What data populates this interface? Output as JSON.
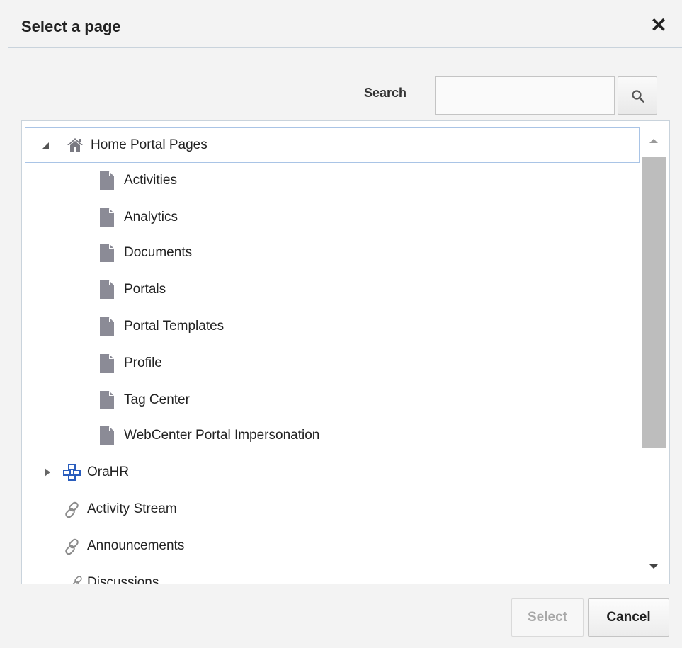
{
  "dialog": {
    "title": "Select a page",
    "close_symbol": "✕"
  },
  "search": {
    "label": "Search",
    "value": "",
    "placeholder": ""
  },
  "tree": {
    "root": {
      "label": "Home Portal Pages",
      "icon": "home-icon",
      "expanded": true,
      "children": [
        "Activities",
        "Analytics",
        "Documents",
        "Portals",
        "Portal Templates",
        "Profile",
        "Tag Center",
        "WebCenter Portal Impersonation"
      ]
    },
    "portal_node": {
      "label": "OraHR",
      "icon": "portal-network-icon",
      "expanded": false
    },
    "links": [
      {
        "label": "Activity Stream",
        "icon": "link-icon"
      },
      {
        "label": "Announcements",
        "icon": "link-icon"
      },
      {
        "label": "Discussions",
        "icon": "link-icon"
      }
    ]
  },
  "buttons": {
    "select": "Select",
    "cancel": "Cancel"
  },
  "colors": {
    "background": "#f3f3f3",
    "selection_border": "#a9c4e6",
    "page_icon": "#8b8b96",
    "portal_icon": "#2a5dbd",
    "scroll_thumb": "#bdbdbd"
  }
}
